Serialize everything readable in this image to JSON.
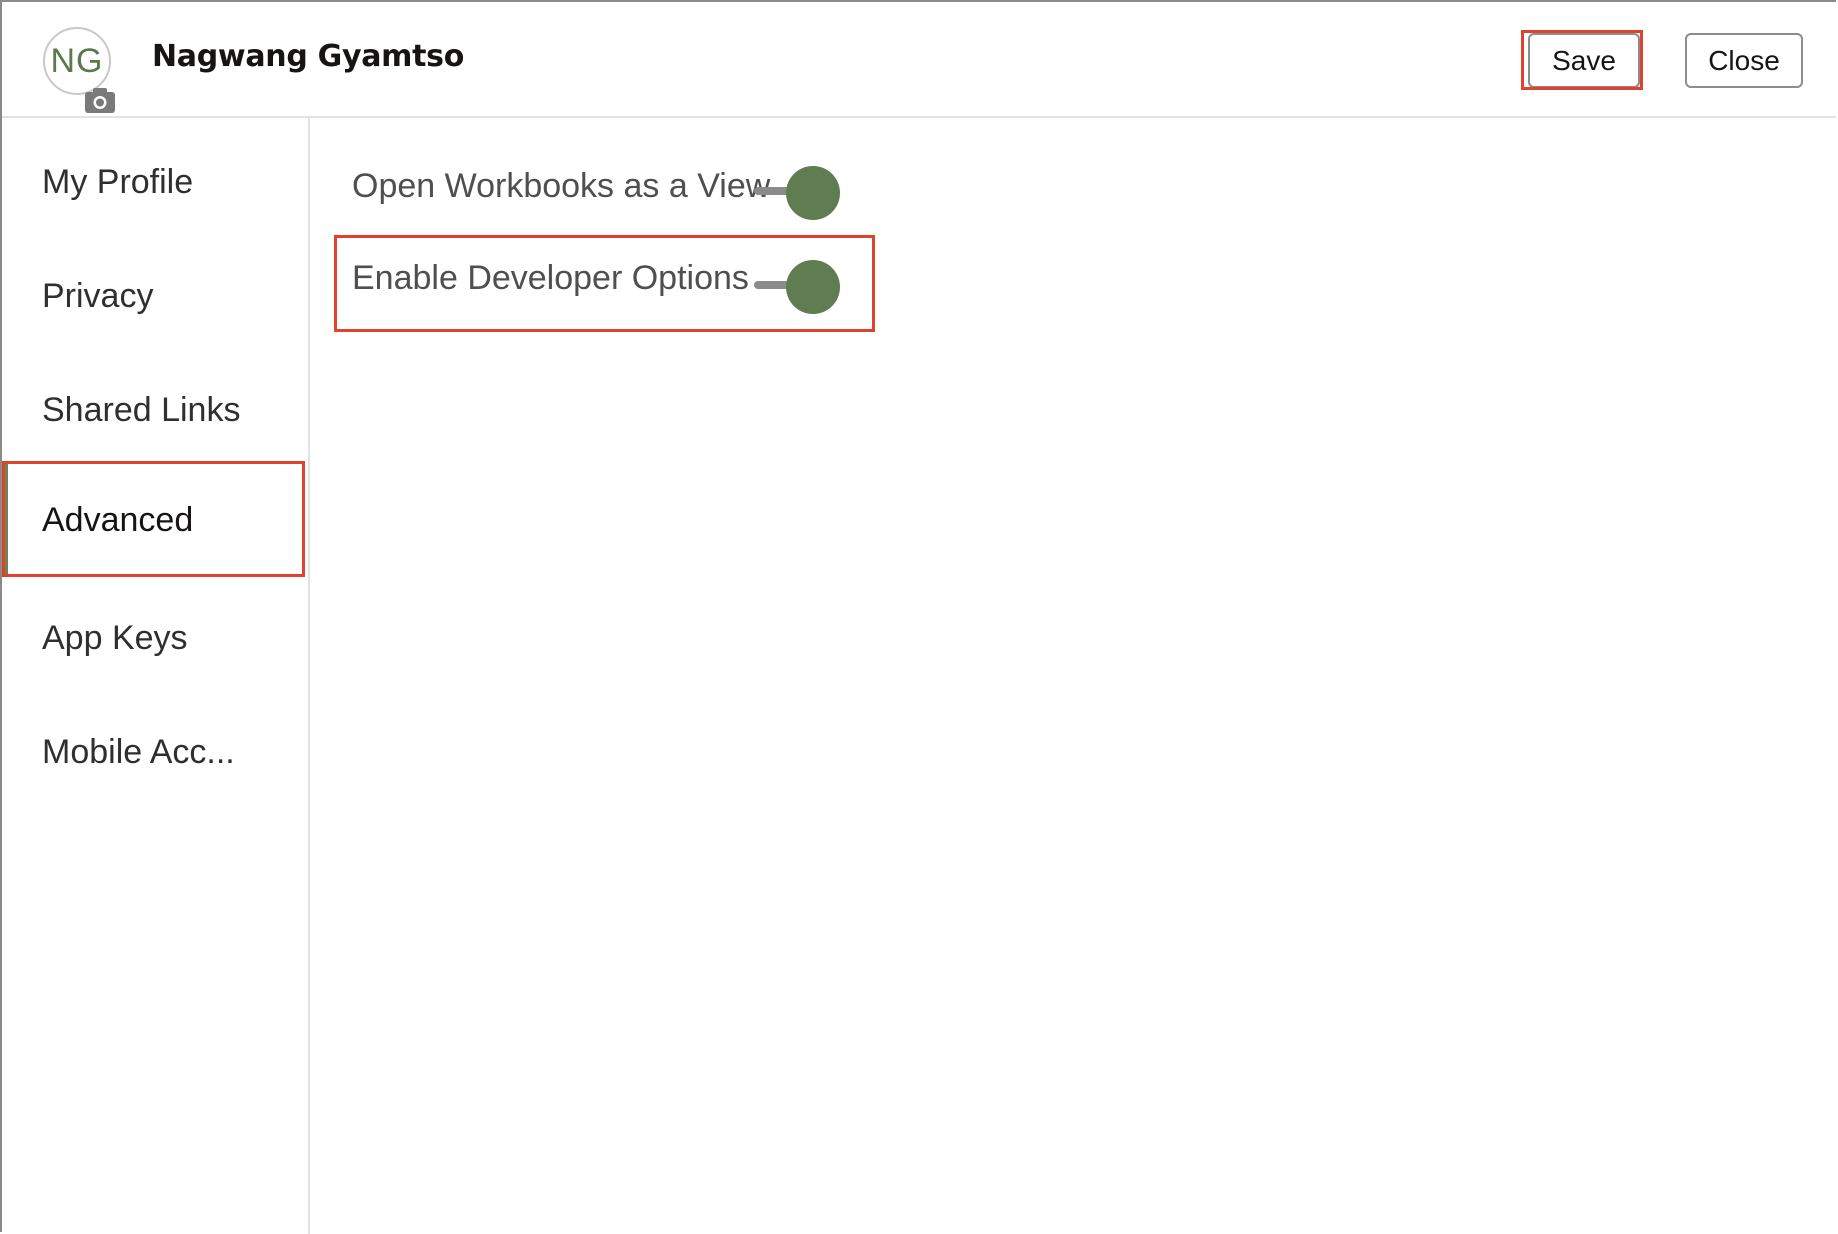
{
  "header": {
    "avatar_initials": "NG",
    "user_name": "Nagwang Gyamtso",
    "save_label": "Save",
    "close_label": "Close"
  },
  "sidebar": {
    "items": [
      {
        "label": "My Profile"
      },
      {
        "label": "Privacy"
      },
      {
        "label": "Shared Links"
      },
      {
        "label": "Advanced",
        "active": true
      },
      {
        "label": "App Keys"
      },
      {
        "label": "Mobile Acc..."
      }
    ]
  },
  "main": {
    "options": [
      {
        "label": "Open Workbooks as a View",
        "state": "on"
      },
      {
        "label": "Enable Developer Options",
        "state": "on"
      }
    ]
  },
  "colors": {
    "accent": "#5f7d51",
    "highlight": "#e0432b",
    "active_bar": "#6a8456"
  },
  "icons": {
    "avatar_overlay": "camera-icon"
  }
}
